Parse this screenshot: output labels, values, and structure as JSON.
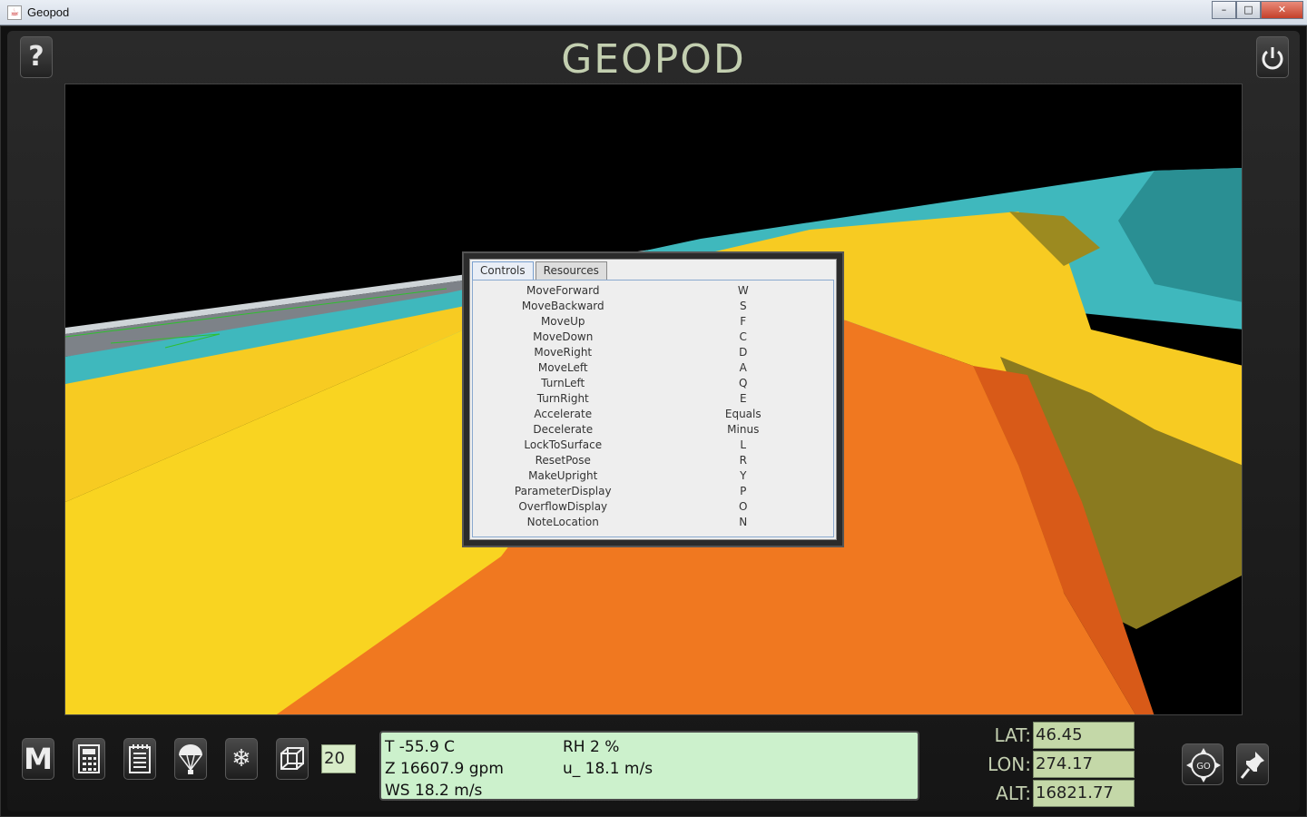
{
  "window": {
    "title": "Geopod",
    "min_glyph": "–",
    "max_glyph": "□",
    "close_glyph": "✕"
  },
  "header": {
    "logo": "GEOPOD",
    "help_glyph": "?"
  },
  "dialog": {
    "tabs": [
      {
        "label": "Controls",
        "active": true
      },
      {
        "label": "Resources",
        "active": false
      }
    ],
    "controls": [
      {
        "action": "MoveForward",
        "key": "W"
      },
      {
        "action": "MoveBackward",
        "key": "S"
      },
      {
        "action": "MoveUp",
        "key": "F"
      },
      {
        "action": "MoveDown",
        "key": "C"
      },
      {
        "action": "MoveRight",
        "key": "D"
      },
      {
        "action": "MoveLeft",
        "key": "A"
      },
      {
        "action": "TurnLeft",
        "key": "Q"
      },
      {
        "action": "TurnRight",
        "key": "E"
      },
      {
        "action": "Accelerate",
        "key": "Equals"
      },
      {
        "action": "Decelerate",
        "key": "Minus"
      },
      {
        "action": "LockToSurface",
        "key": "L"
      },
      {
        "action": "ResetPose",
        "key": "R"
      },
      {
        "action": "MakeUpright",
        "key": "Y"
      },
      {
        "action": "ParameterDisplay",
        "key": "P"
      },
      {
        "action": "OverflowDisplay",
        "key": "O"
      },
      {
        "action": "NoteLocation",
        "key": "N"
      }
    ]
  },
  "toolbar": {
    "m_glyph": "M",
    "number_box_value": "20",
    "icons": [
      "m-icon",
      "calculator-icon",
      "notepad-icon",
      "parachute-icon",
      "snowflake-icon",
      "cube-icon"
    ]
  },
  "readout": {
    "temperature": "T  -55.9 C",
    "height": "Z  16607.9 gpm",
    "wind_speed": "WS  18.2 m/s",
    "humidity": "RH  2 %",
    "u_wind": "u_  18.1 m/s"
  },
  "coords": {
    "lat_label": "LAT:",
    "lat_value": "46.45",
    "lon_label": "LON:",
    "lon_value": "274.17",
    "alt_label": "ALT:",
    "alt_value": "16821.77"
  },
  "go_label": "GO",
  "colors": {
    "yellow_surface": "#f7cb22",
    "orange_surface": "#f07820",
    "teal_surface": "#3fb8bd",
    "readout_bg": "#ccf1cc",
    "coord_bg": "#c4d8a8",
    "logo": "#c3cfb0"
  }
}
